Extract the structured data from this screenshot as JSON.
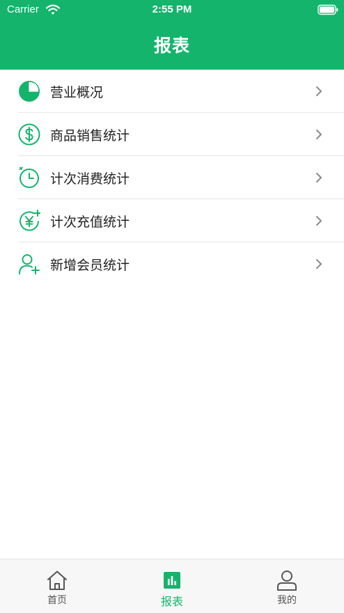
{
  "status_bar": {
    "carrier": "Carrier",
    "time": "2:55 PM"
  },
  "header": {
    "title": "报表"
  },
  "colors": {
    "accent": "#14b46c"
  },
  "menu": [
    {
      "label": "营业概况",
      "icon": "pie-chart-icon"
    },
    {
      "label": "商品销售统计",
      "icon": "dollar-circle-icon"
    },
    {
      "label": "计次消费统计",
      "icon": "clock-icon"
    },
    {
      "label": "计次充值统计",
      "icon": "yen-plus-icon"
    },
    {
      "label": "新增会员统计",
      "icon": "add-user-icon"
    }
  ],
  "tabbar": [
    {
      "label": "首页",
      "icon": "home-icon"
    },
    {
      "label": "报表",
      "icon": "bar-chart-icon",
      "active": true
    },
    {
      "label": "我的",
      "icon": "user-icon"
    }
  ]
}
